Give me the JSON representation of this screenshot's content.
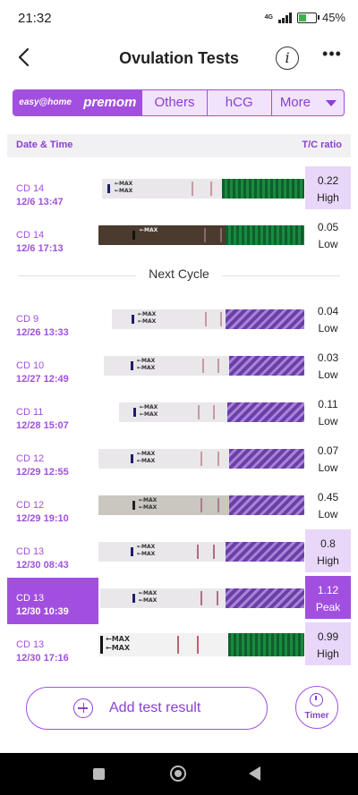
{
  "status": {
    "time": "21:32",
    "network": "4G",
    "battery": "45%"
  },
  "header": {
    "title": "Ovulation Tests"
  },
  "brands": [
    {
      "label": "easy@home"
    },
    {
      "label": "premom"
    },
    {
      "label": "Others"
    },
    {
      "label": "hCG"
    },
    {
      "label": "More"
    }
  ],
  "columns": {
    "date": "Date & Time",
    "ratio": "T/C ratio"
  },
  "separator": "Next Cycle",
  "tests": [
    {
      "cd": "CD 14",
      "datetime": "12/6  13:47",
      "ratio": "0.22",
      "level": "High"
    },
    {
      "cd": "CD 14",
      "datetime": "12/6  17:13",
      "ratio": "0.05",
      "level": "Low"
    },
    {
      "cd": "CD 9",
      "datetime": "12/26  13:33",
      "ratio": "0.04",
      "level": "Low"
    },
    {
      "cd": "CD 10",
      "datetime": "12/27  12:49",
      "ratio": "0.03",
      "level": "Low"
    },
    {
      "cd": "CD 11",
      "datetime": "12/28  15:07",
      "ratio": "0.11",
      "level": "Low"
    },
    {
      "cd": "CD 12",
      "datetime": "12/29  12:55",
      "ratio": "0.07",
      "level": "Low"
    },
    {
      "cd": "CD 12",
      "datetime": "12/29  19:10",
      "ratio": "0.45",
      "level": "Low"
    },
    {
      "cd": "CD 13",
      "datetime": "12/30  08:43",
      "ratio": "0.8",
      "level": "High"
    },
    {
      "cd": "CD 13",
      "datetime": "12/30  10:39",
      "ratio": "1.12",
      "level": "Peak"
    },
    {
      "cd": "CD 13",
      "datetime": "12/30  17:16",
      "ratio": "0.99",
      "level": "High"
    }
  ],
  "actions": {
    "add": "Add test result",
    "timer": "Timer"
  },
  "colors": {
    "accent": "#a24fe0",
    "highlight": "#e8d7f8"
  }
}
